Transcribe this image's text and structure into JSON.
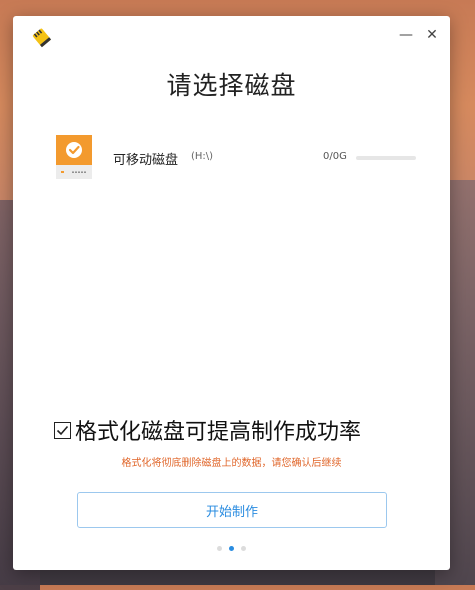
{
  "window": {
    "minimize_glyph": "—",
    "close_glyph": "✕",
    "logo_icon": "sd-card-icon"
  },
  "title": "请选择磁盘",
  "disk": {
    "name": "可移动磁盘",
    "path": "(H:\\)",
    "capacity": "0/0G",
    "usage_fraction": 0
  },
  "format": {
    "checked": true,
    "label": "格式化磁盘可提高制作成功率",
    "warning": "格式化将彻底删除磁盘上的数据，请您确认后继续"
  },
  "start_button": "开始制作",
  "pager": {
    "count": 3,
    "active": 1
  },
  "colors": {
    "accent": "#2a8ce0",
    "warning": "#e0662a",
    "disk_orange": "#f39a2e"
  }
}
